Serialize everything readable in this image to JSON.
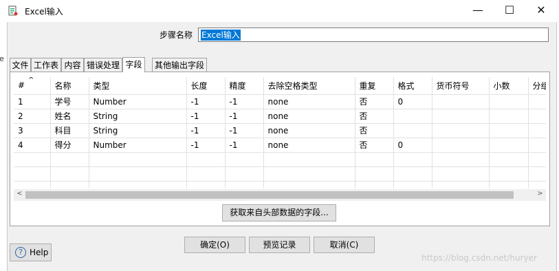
{
  "window": {
    "title": "Excel输入",
    "controls": {
      "minimize": "—",
      "maximize": "☐",
      "close": "✕"
    }
  },
  "background_fragment": "e",
  "step": {
    "label": "步骤名称",
    "value": "Excel输入"
  },
  "tabs": [
    {
      "label": "文件",
      "active": false
    },
    {
      "label": "工作表",
      "active": false
    },
    {
      "label": "内容",
      "active": false
    },
    {
      "label": "错误处理",
      "active": false
    },
    {
      "label": "字段",
      "active": true
    },
    {
      "label": "其他输出字段",
      "active": false
    }
  ],
  "table": {
    "sort_indicator": "^",
    "columns": [
      "#",
      "名称",
      "类型",
      "长度",
      "精度",
      "去除空格类型",
      "重复",
      "格式",
      "货币符号",
      "小数",
      "分组"
    ],
    "rows": [
      [
        "1",
        "学号",
        "Number",
        "-1",
        "-1",
        "none",
        "否",
        "0",
        "",
        "",
        ""
      ],
      [
        "2",
        "姓名",
        "String",
        "-1",
        "-1",
        "none",
        "否",
        "",
        "",
        "",
        ""
      ],
      [
        "3",
        "科目",
        "String",
        "-1",
        "-1",
        "none",
        "否",
        "",
        "",
        "",
        ""
      ],
      [
        "4",
        "得分",
        "Number",
        "-1",
        "-1",
        "none",
        "否",
        "0",
        "",
        "",
        ""
      ],
      [
        "",
        "",
        "",
        "",
        "",
        "",
        "",
        "",
        "",
        "",
        ""
      ],
      [
        "",
        "",
        "",
        "",
        "",
        "",
        "",
        "",
        "",
        "",
        ""
      ],
      [
        "",
        "",
        "",
        "",
        "",
        "",
        "",
        "",
        "",
        "",
        ""
      ]
    ]
  },
  "scrollbar": {
    "left_arrow": "<",
    "right_arrow": ">"
  },
  "buttons": {
    "get_fields": "获取来自头部数据的字段...",
    "ok": "确定(O)",
    "preview": "预览记录",
    "cancel": "取消(C)",
    "help": "Help",
    "help_icon_glyph": "?"
  },
  "watermark": "https://blog.csdn.net/huryer"
}
